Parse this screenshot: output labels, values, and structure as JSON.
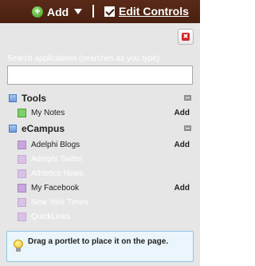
{
  "topbar": {
    "add_label": "Add",
    "edit_controls_label": "Edit Controls"
  },
  "panel": {
    "search_hint": "Search applications (searches as you type).",
    "search_value": "",
    "groups": [
      {
        "label": "Tools",
        "items": [
          {
            "label": "My Notes",
            "action": "Add",
            "enabled": true
          }
        ]
      },
      {
        "label": "eCampus",
        "items": [
          {
            "label": "Adelphi Blogs",
            "action": "Add",
            "enabled": true
          },
          {
            "label": "Adelphi Twitter",
            "action": "",
            "enabled": false
          },
          {
            "label": "Athletics News",
            "action": "",
            "enabled": false
          },
          {
            "label": "My Facebook",
            "action": "Add",
            "enabled": true
          },
          {
            "label": "New York Times",
            "action": "",
            "enabled": false
          },
          {
            "label": "QuickLinks",
            "action": "",
            "enabled": false
          }
        ]
      }
    ],
    "tip": "Drag a portlet to place it on the page."
  }
}
